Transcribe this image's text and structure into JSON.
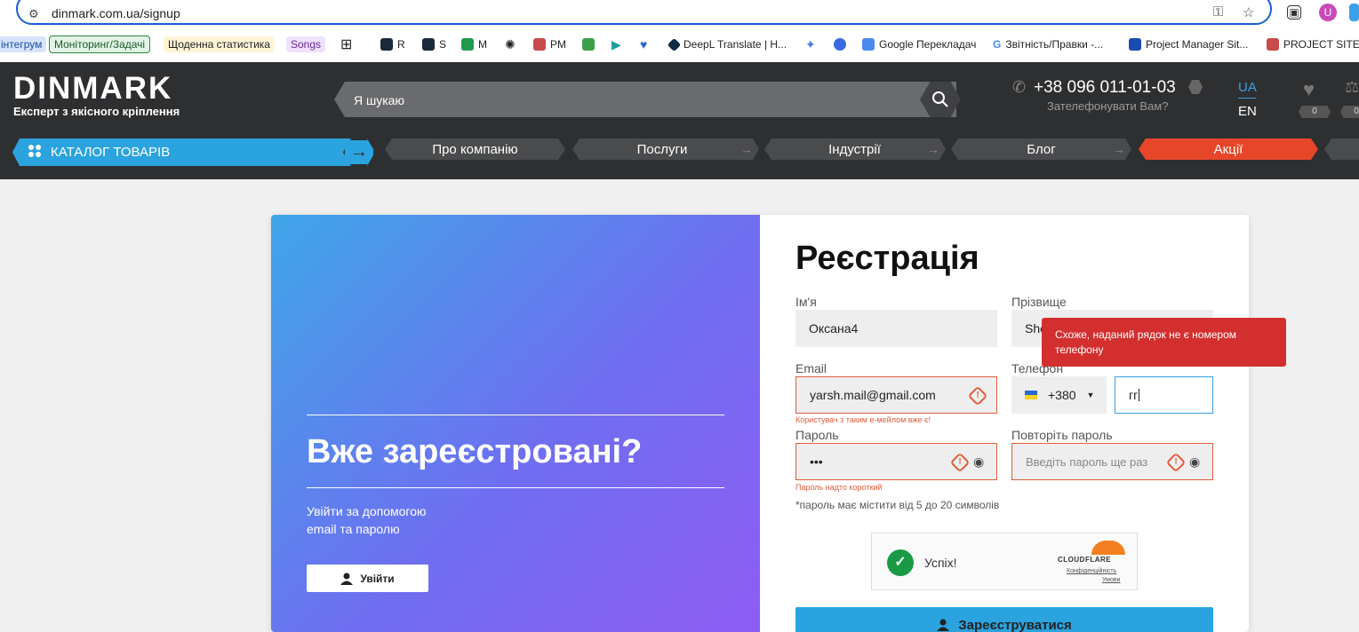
{
  "browser": {
    "url": "dinmark.com.ua/signup",
    "bookmarks": [
      {
        "label": "інтегрум",
        "color": "#d6e4ff"
      },
      {
        "label": "Моніторинг/Задачі",
        "color": "#e3f4e6"
      },
      {
        "label": "Щоденна статистика",
        "color": "#fff4d6"
      },
      {
        "label": "Songs",
        "color": "#f0e0ff"
      },
      {
        "label": "R"
      },
      {
        "label": "S"
      },
      {
        "label": "M"
      },
      {
        "label": "PM"
      },
      {
        "label": "DeepL Translate | H..."
      },
      {
        "label": "Google Перекладач"
      },
      {
        "label": "Звітність/Правки -..."
      },
      {
        "label": "Project Manager Sit..."
      },
      {
        "label": "PROJECT SITE |"
      }
    ]
  },
  "header": {
    "logo": "DINMARK",
    "tagline": "Експерт з якісного кріплення",
    "search_placeholder": "Я шукаю",
    "phone": "+38 096 011-01-03",
    "callback": "Зателефонувати Вам?",
    "lang_ua": "UA",
    "lang_en": "EN",
    "wishlist_count": "0",
    "compare_count": "0"
  },
  "nav": {
    "catalog": "КАТАЛОГ ТОВАРІВ",
    "items": [
      "Про компанію",
      "Послуги",
      "Індустрії",
      "Блог",
      "Акції"
    ]
  },
  "login_panel": {
    "title": "Вже зареєстровані?",
    "text": "Увійти за допомогою\nemail та паролю",
    "button": "Увійти"
  },
  "form": {
    "title": "Реєстрація",
    "first_name_label": "Ім'я",
    "first_name": "Оксана4",
    "last_name_label": "Прізвище",
    "last_name": "Sho",
    "email_label": "Email",
    "email": "yarsh.mail@gmail.com",
    "email_error": "Користувач з таким е-мейлом вже є!",
    "phone_label": "Телефон",
    "phone_code": "+380",
    "phone_value": "гг",
    "password_label": "Пароль",
    "password_value": "•••",
    "password_error": "Пароль надто короткий",
    "repeat_label": "Повторіть пароль",
    "repeat_placeholder": "Введіть пароль ще раз",
    "hint": "*пароль має містити від 5 до 20 символів",
    "submit": "Зареєструватися"
  },
  "tooltip": "Схоже, наданий рядок не є номером телефону",
  "captcha": {
    "status": "Успіх!",
    "brand": "CLOUDFLARE",
    "privacy": "Конфіденційність",
    "terms": "Умови"
  },
  "colors": {
    "accent": "#2aa3df",
    "promo": "#e84629",
    "error": "#d42f2f",
    "header": "#2e2f31"
  }
}
